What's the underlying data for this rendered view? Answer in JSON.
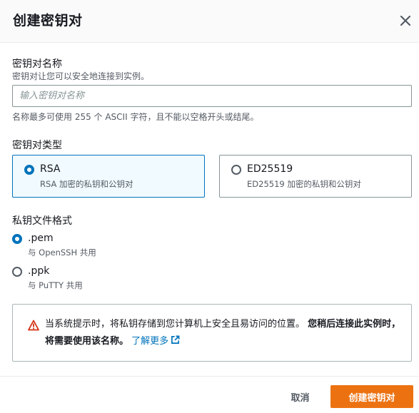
{
  "dialog": {
    "title": "创建密钥对"
  },
  "key_name": {
    "label": "密钥对名称",
    "description": "密钥对让您可以安全地连接到实例。",
    "placeholder": "输入密钥对名称",
    "value": "",
    "constraint": "名称最多可使用 255 个 ASCII 字符，且不能以空格开头或结尾。"
  },
  "key_type": {
    "label": "密钥对类型",
    "options": [
      {
        "title": "RSA",
        "description": "RSA 加密的私钥和公钥对",
        "selected": true
      },
      {
        "title": "ED25519",
        "description": "ED25519 加密的私钥和公钥对",
        "selected": false
      }
    ]
  },
  "file_format": {
    "label": "私钥文件格式",
    "options": [
      {
        "title": ".pem",
        "description": "与 OpenSSH 共用",
        "selected": true
      },
      {
        "title": ".ppk",
        "description": "与 PuTTY 共用",
        "selected": false
      }
    ]
  },
  "alert": {
    "icon": "warning-icon",
    "text": "当系统提示时，将私钥存储到您计算机上安全且易访问的位置。",
    "bold_text": "您稍后连接此实例时，将需要使用该名称。",
    "link": "了解更多",
    "link_icon": "external-link-icon"
  },
  "footer": {
    "cancel_label": "取消",
    "create_label": "创建密钥对"
  },
  "colors": {
    "accent": "#0073bb",
    "primary_button": "#ec7211",
    "warning": "#d13212"
  }
}
